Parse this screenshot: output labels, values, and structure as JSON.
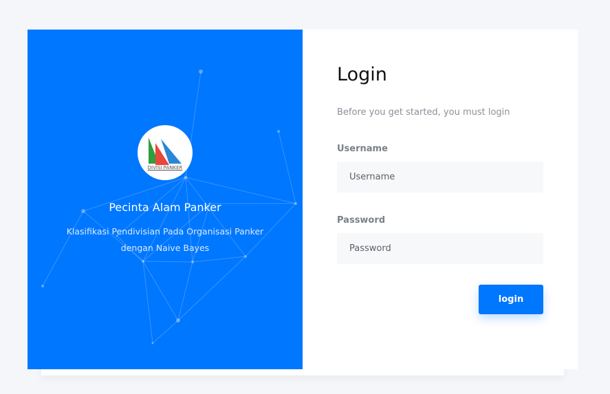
{
  "brand": {
    "logo_text": "DIVISI PANKER",
    "title": "Pecinta Alam Panker",
    "subtitle": "Klasifikasi Pendivisian Pada Organisasi Panker dengan Naive Bayes",
    "accent_color": "#0077ff"
  },
  "login": {
    "title": "Login",
    "subtitle": "Before you get started, you must login",
    "username_label": "Username",
    "username_placeholder": "Username",
    "username_value": "",
    "password_label": "Password",
    "password_placeholder": "Password",
    "password_value": "",
    "submit_label": "login"
  }
}
